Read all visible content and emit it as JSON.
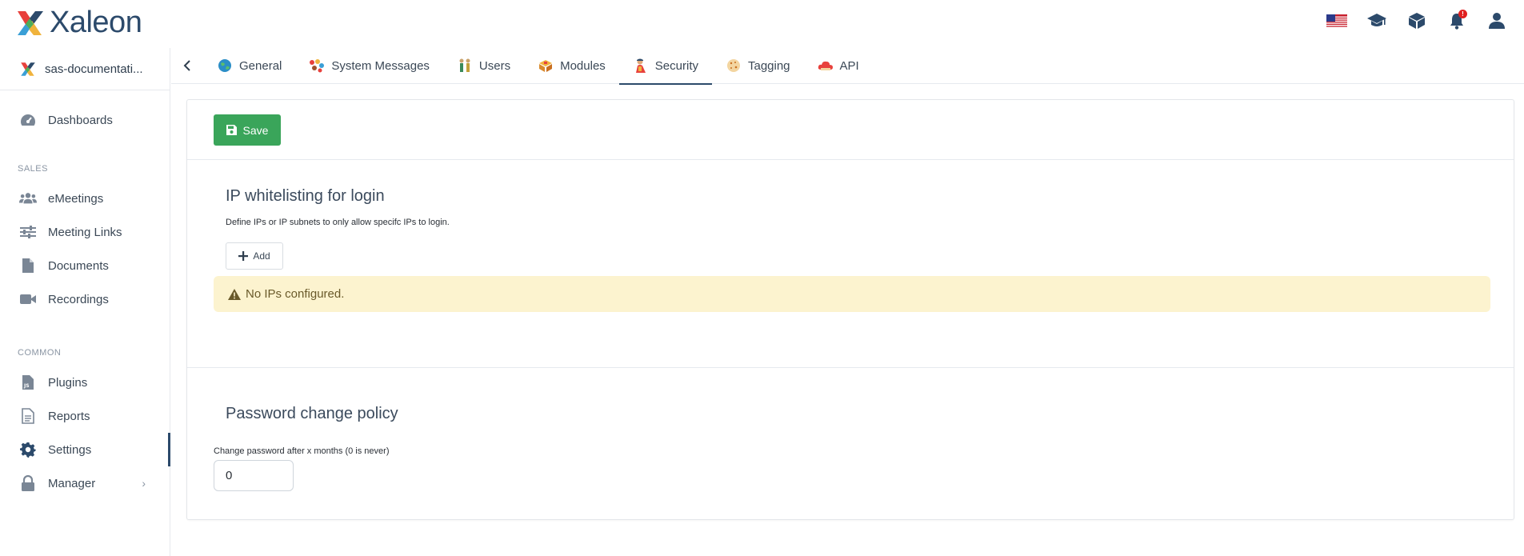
{
  "app": {
    "name": "Xaleon"
  },
  "header": {
    "icons": [
      "us-flag-icon",
      "graduation-cap-icon",
      "box-icon",
      "bell-icon",
      "user-icon"
    ],
    "notification_count": "!"
  },
  "sidebar": {
    "workspace": "sas-documentati...",
    "dashboards": "Dashboards",
    "section_sales": "SALES",
    "sales_items": [
      "eMeetings",
      "Meeting Links",
      "Documents",
      "Recordings"
    ],
    "section_common": "COMMON",
    "common_items": [
      "Plugins",
      "Reports",
      "Settings",
      "Manager"
    ],
    "active_item": "Settings"
  },
  "tabs": {
    "items": [
      "General",
      "System Messages",
      "Users",
      "Modules",
      "Security",
      "Tagging",
      "API"
    ],
    "active": "Security"
  },
  "toolbar": {
    "save_label": "Save"
  },
  "ip_whitelist": {
    "title": "IP whitelisting for login",
    "description": "Define IPs or IP subnets to only allow specifc IPs to login.",
    "add_label": "Add",
    "empty_message": "No IPs configured."
  },
  "password_policy": {
    "title": "Password change policy",
    "field_label": "Change password after x months (0 is never)",
    "value": "0"
  },
  "colors": {
    "brand": "#2c4a6b",
    "save_button": "#3aa55a",
    "warning_bg": "#fcf3cf"
  }
}
